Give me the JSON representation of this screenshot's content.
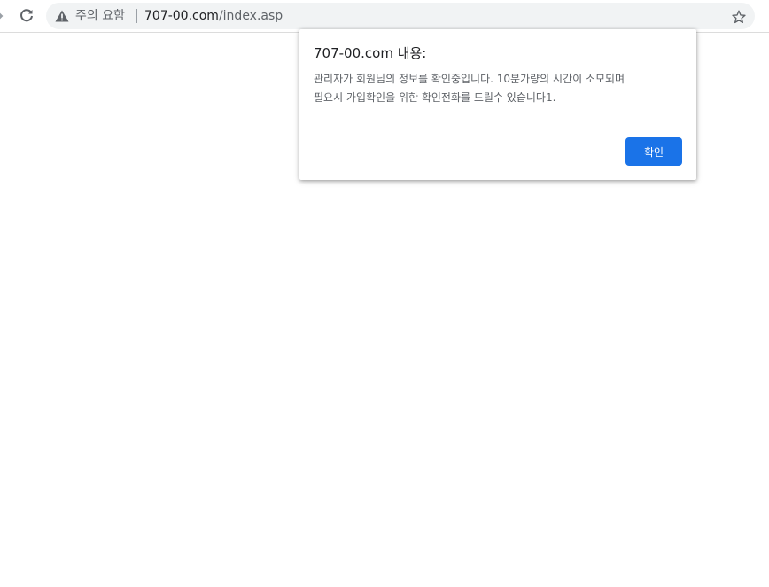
{
  "browser": {
    "security_label": "주의 요함",
    "url_host": "707-00.com",
    "url_path": "/index.asp",
    "icons": {
      "forward": "forward-arrow-icon",
      "reload": "reload-icon",
      "security": "warning-triangle-icon",
      "bookmark": "star-icon"
    }
  },
  "dialog": {
    "title": "707-00.com 내용:",
    "message_lines": [
      "관리자가 회원님의 정보를 확인중입니다. 10분가량의 시간이 소모되며",
      "필요시 가입확인을 위한 확인전화를 드릴수 있습니다1."
    ],
    "ok_label": "확인"
  },
  "colors": {
    "accent": "#1a73e8",
    "omnibox_bg": "#f1f3f4",
    "text_primary": "#202124",
    "text_secondary": "#5f6368"
  }
}
